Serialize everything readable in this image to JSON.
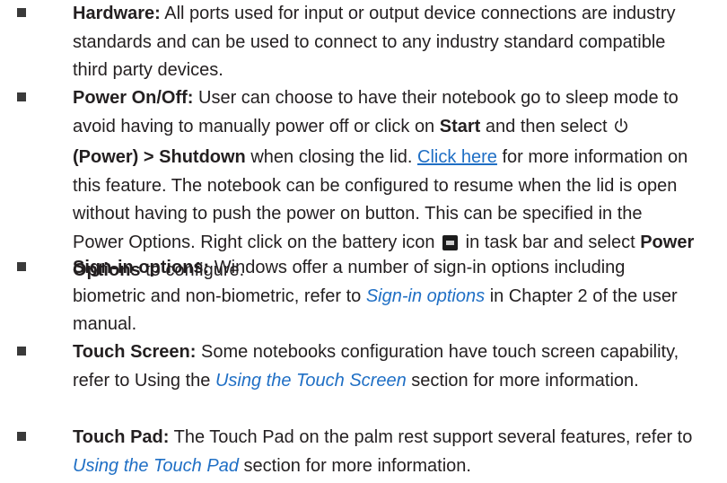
{
  "items": [
    {
      "title": "Hardware:",
      "text": "All ports used for input or output device connections are industry standards and can be used to connect to any industry standard compatible third party devices."
    },
    {
      "title": "Power On/Off:",
      "t1": "User can choose to have their notebook go to sleep mode to avoid having to manually power off or click on",
      "b1": "Start",
      "t2": "and then select",
      "b2": "(Power) > Shutdown",
      "t3": "when closing the lid.",
      "link": "Click here",
      "t4": "for more information on this feature. The notebook can be configured to resume when the lid is open without having to push the power on button. This can be specified in the Power Options. Right click on the battery icon",
      "t5": "in task bar and select",
      "b3": "Power Options",
      "t6": "to configure."
    },
    {
      "title": "Sign-in options:",
      "t1": "Windows offer a number of sign-in options including biometric and non-biometric, refer to",
      "ref": "Sign-in options",
      "t2": "in Chapter 2 of the user manual."
    },
    {
      "title": "Touch Screen:",
      "t1": "Some notebooks configuration have touch screen capability, refer to Using the",
      "ref": "Using the Touch Screen",
      "t2": "section for more information."
    },
    {
      "title": "Touch Pad:",
      "t1": "The Touch Pad on the palm rest support several features, refer to",
      "ref": "Using the Touch Pad",
      "t2": "section for more information."
    }
  ],
  "icons": [
    "power-icon",
    "battery-icon"
  ],
  "colors": {
    "text": "#231f20",
    "link": "#1f6fc5",
    "bullet": "#3a3a3a"
  }
}
